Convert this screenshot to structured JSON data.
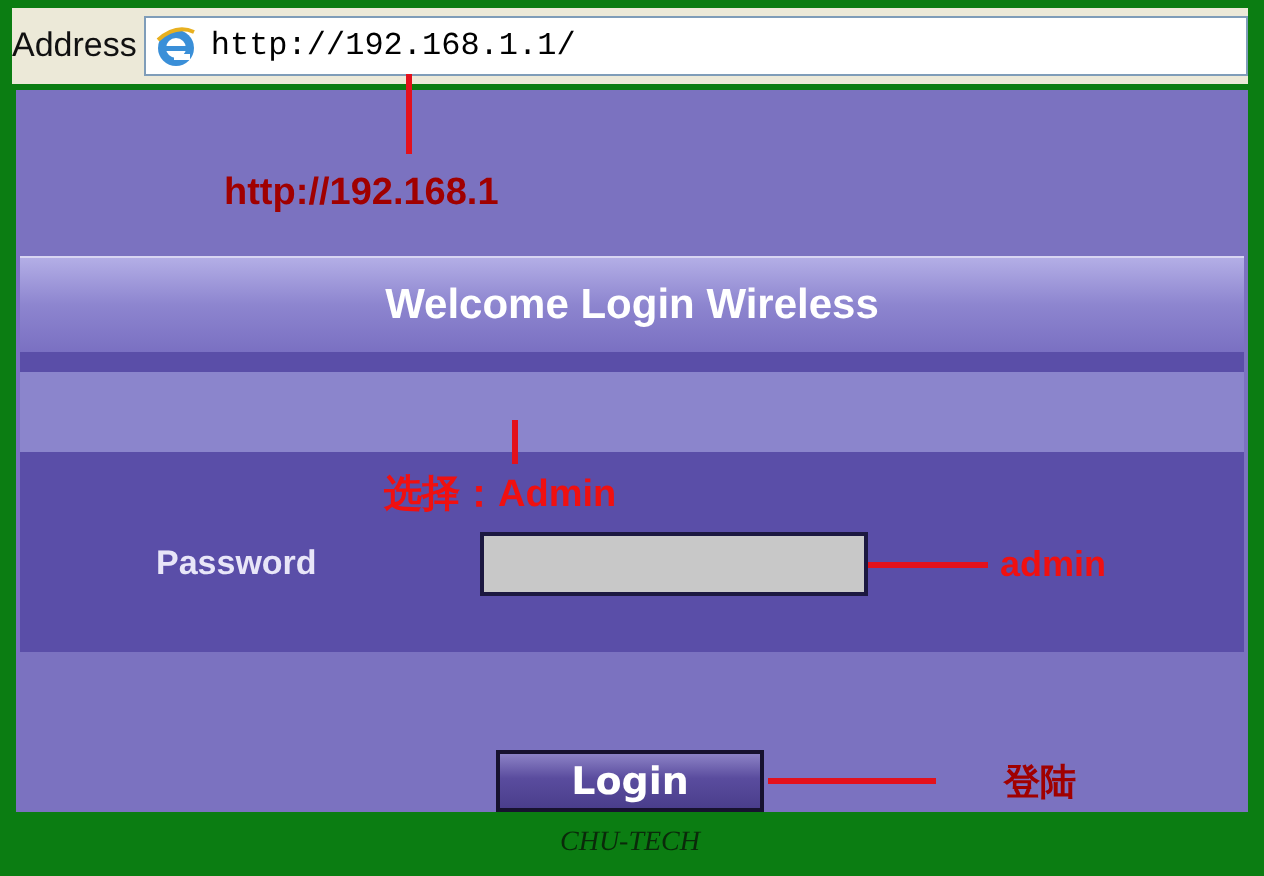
{
  "address_bar": {
    "label": "Address",
    "url": "http://192.168.1.1/"
  },
  "annotation_url": "http://192.168.1",
  "header": {
    "title": "Welcome Login Wireless"
  },
  "annotation_user": "选择：Admin",
  "password": {
    "label": "Password"
  },
  "annotation_password": "admin",
  "login_button": {
    "label": "Login"
  },
  "annotation_login": "登陆",
  "caption": "CHU-TECH"
}
